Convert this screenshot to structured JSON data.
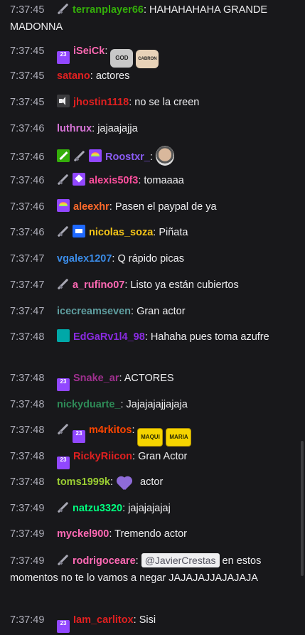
{
  "messages": [
    {
      "time": "7:37:45",
      "badges": [
        "sword-icon"
      ],
      "user": "terranplayer66",
      "color": "#34ae0a",
      "text": "HAHAHAHAHA GRANDE MADONNA"
    },
    {
      "time": "7:37:45",
      "badges": [
        "sub-23-icon"
      ],
      "user": "iSeiCk",
      "color": "#ff69b4",
      "text": "",
      "emotes": [
        "GOD",
        "CABRON"
      ]
    },
    {
      "time": "7:37:45",
      "badges": [],
      "user": "satano",
      "color": "#e02020",
      "text": "actores"
    },
    {
      "time": "7:37:45",
      "badges": [
        "mute-icon"
      ],
      "user": "jhostin1118",
      "color": "#e02020",
      "text": "no se la creen"
    },
    {
      "time": "7:37:46",
      "badges": [],
      "user": "luthrux",
      "color": "#d774d7",
      "text": "jajaajajja"
    },
    {
      "time": "7:37:46",
      "badges": [
        "green-sword-icon",
        "sword-icon",
        "rainbow-icon"
      ],
      "user": "Roostxr_",
      "color": "#8a5cf5",
      "text": "",
      "emotes": [
        "face"
      ]
    },
    {
      "time": "7:37:46",
      "badges": [
        "sword-icon",
        "purple-gem-icon"
      ],
      "user": "alexis50f3",
      "color": "#ff4f9e",
      "text": "tomaaaa"
    },
    {
      "time": "7:37:46",
      "badges": [
        "rainbow-icon"
      ],
      "user": "aleexhr",
      "color": "#ff6a2b",
      "text": "Pasen el paypal de ya"
    },
    {
      "time": "7:37:46",
      "badges": [
        "sword-icon",
        "crown-icon"
      ],
      "user": "nicolas_soza",
      "color": "#f5c518",
      "text": "Piñata"
    },
    {
      "time": "7:37:47",
      "badges": [],
      "user": "vgalex1207",
      "color": "#3b8ce8",
      "text": "Q rápido picas"
    },
    {
      "time": "7:37:47",
      "badges": [
        "sword-icon"
      ],
      "user": "a_rufino07",
      "color": "#ff69b4",
      "text": "Listo ya están cubiertos"
    },
    {
      "time": "7:37:47",
      "badges": [],
      "user": "icecreamseven",
      "color": "#5f9ea0",
      "text": "Gran actor"
    },
    {
      "time": "7:37:48",
      "badges": [
        "teal-icon"
      ],
      "user": "EdGaRv1l4_98",
      "color": "#8a2be2",
      "text": "Hahaha pues toma azufre"
    },
    {
      "time": "7:37:48",
      "badges": [
        "sub-23-icon"
      ],
      "user": "Snake_ar",
      "color": "#a0308f",
      "text": "ACTORES"
    },
    {
      "time": "7:37:48",
      "badges": [],
      "user": "nickyduarte_",
      "color": "#2e8b57",
      "text": "Jajajajajjajaja"
    },
    {
      "time": "7:37:48",
      "badges": [
        "sword-icon",
        "sub-23-icon"
      ],
      "user": "m4rkitos",
      "color": "#ff4500",
      "text": "",
      "emotes": [
        "MAQUI",
        "MARIA"
      ]
    },
    {
      "time": "7:37:48",
      "badges": [
        "sub-23-icon"
      ],
      "user": "RickyRiicon",
      "color": "#e02020",
      "text": "Gran Actor"
    },
    {
      "time": "7:37:48",
      "badges": [],
      "user": "toms1999k",
      "color": "#9acd32",
      "text": "actor",
      "emotes": [
        "heart"
      ]
    },
    {
      "time": "7:37:49",
      "badges": [
        "sword-icon"
      ],
      "user": "natzu3320",
      "color": "#00ff7f",
      "text": "jajajajajaj"
    },
    {
      "time": "7:37:49",
      "badges": [],
      "user": "myckel900",
      "color": "#ff69b4",
      "text": "Tremendo actor"
    },
    {
      "time": "7:37:49",
      "badges": [
        "sword-icon"
      ],
      "user": "rodrigoceare",
      "color": "#ff69b4",
      "mention": "@JavierCrestas",
      "text": "en estos momentos no te lo vamos a negar JAJAJAJJAJAJAJA"
    },
    {
      "time": "7:37:49",
      "badges": [
        "sub-23-icon"
      ],
      "user": "Iam_carlitox",
      "color": "#e02020",
      "text": "Sisi"
    }
  ],
  "sub_badge_label": "23"
}
